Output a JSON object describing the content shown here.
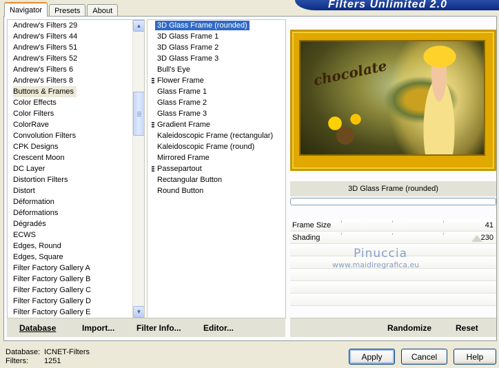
{
  "window": {
    "banner_title": "Filters Unlimited 2.0"
  },
  "tabs": [
    {
      "label": "Navigator",
      "active": true
    },
    {
      "label": "Presets",
      "active": false
    },
    {
      "label": "About",
      "active": false
    }
  ],
  "categories": {
    "selected": "Buttons & Frames",
    "items": [
      "Andrew's Filters 29",
      "Andrew's Filters 44",
      "Andrew's Filters 51",
      "Andrew's Filters 52",
      "Andrew's Filters 6",
      "Andrew's Filters 8",
      "Buttons & Frames",
      "Color Effects",
      "Color Filters",
      "ColorRave",
      "Convolution Filters",
      "CPK Designs",
      "Crescent Moon",
      "DC Layer",
      "Distortion Filters",
      "Distort",
      "Déformation",
      "Déformations",
      "Dégradés",
      "ECWS",
      "Edges, Round",
      "Edges, Square",
      "Filter Factory Gallery A",
      "Filter Factory Gallery B",
      "Filter Factory Gallery C",
      "Filter Factory Gallery D",
      "Filter Factory Gallery E"
    ],
    "scroll": {
      "up_icon": "chevron-up-icon",
      "down_icon": "chevron-down-icon"
    }
  },
  "filters": {
    "selected": "3D Glass Frame (rounded)",
    "items": [
      {
        "label": "3D Glass Frame (rounded)",
        "folder": false
      },
      {
        "label": "3D Glass Frame 1",
        "folder": false
      },
      {
        "label": "3D Glass Frame 2",
        "folder": false
      },
      {
        "label": "3D Glass Frame 3",
        "folder": false
      },
      {
        "label": "Bull's Eye",
        "folder": false
      },
      {
        "label": "Flower Frame",
        "folder": true
      },
      {
        "label": "Glass Frame 1",
        "folder": false
      },
      {
        "label": "Glass Frame 2",
        "folder": false
      },
      {
        "label": "Glass Frame 3",
        "folder": false
      },
      {
        "label": "Gradient Frame",
        "folder": true
      },
      {
        "label": "Kaleidoscopic Frame (rectangular)",
        "folder": false
      },
      {
        "label": "Kaleidoscopic Frame (round)",
        "folder": false
      },
      {
        "label": "Mirrored Frame",
        "folder": false
      },
      {
        "label": "Passepartout",
        "folder": true
      },
      {
        "label": "Rectangular Button",
        "folder": false
      },
      {
        "label": "Round Button",
        "folder": false
      }
    ]
  },
  "preview": {
    "caption": "chocolate"
  },
  "current_filter_name": "3D Glass Frame (rounded)",
  "progress": {
    "fraction": 0.0
  },
  "params": [
    {
      "label": "Frame Size",
      "value": "41"
    },
    {
      "label": "Shading",
      "value": "230"
    }
  ],
  "watermark": {
    "line1": "Pinuccia",
    "line2": "www.maidiregrafica.eu"
  },
  "left_buttons": {
    "database": "Database",
    "import": "Import...",
    "filter_info": "Filter Info...",
    "editor": "Editor..."
  },
  "right_buttons": {
    "randomize": "Randomize",
    "reset": "Reset"
  },
  "status": {
    "database_label": "Database:",
    "database_value": "ICNET-Filters",
    "filters_label": "Filters:",
    "filters_value": "1251"
  },
  "dialog_buttons": {
    "apply": "Apply",
    "cancel": "Cancel",
    "help": "Help"
  }
}
